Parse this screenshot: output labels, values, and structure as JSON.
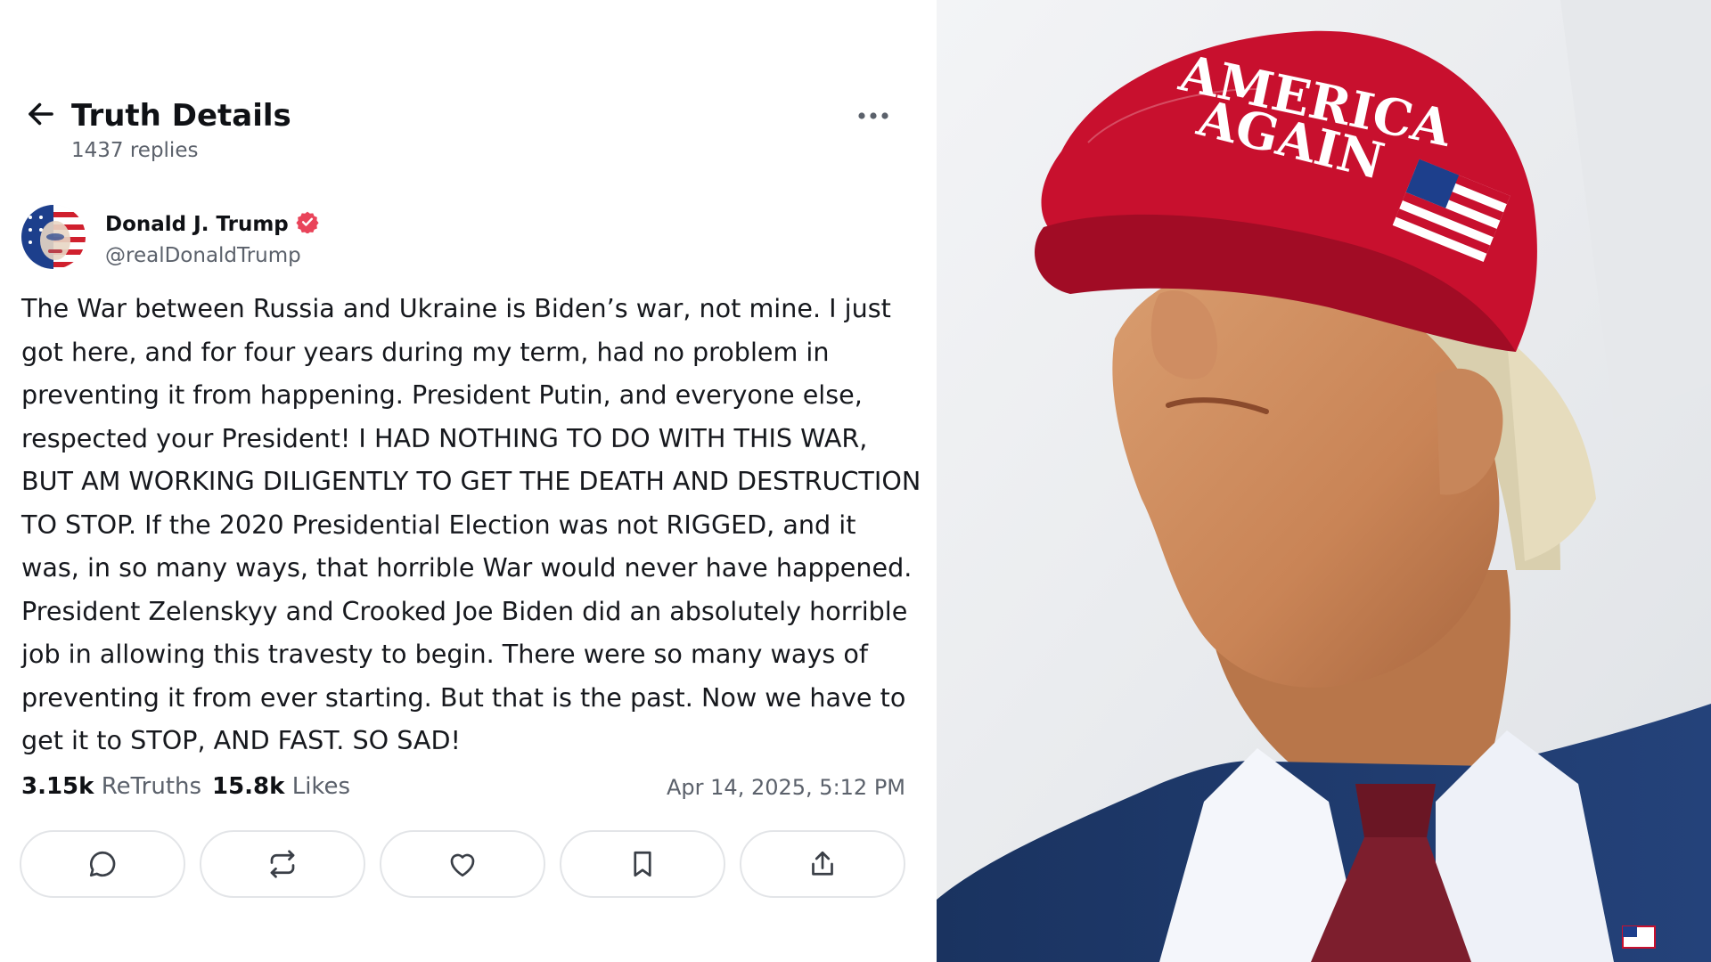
{
  "header": {
    "title": "Truth Details",
    "replies": "1437 replies"
  },
  "post": {
    "author_name": "Donald J. Trump",
    "handle": "@realDonaldTrump",
    "text": "The War between Russia and Ukraine is Biden’s war, not mine. I just got here, and for four years during my term, had no problem in preventing it from happening. President Putin, and everyone else, respected your President! I HAD NOTHING TO DO WITH THIS WAR, BUT AM WORKING DILIGENTLY TO GET THE DEATH AND DESTRUCTION TO STOP. If the 2020 Presidential Election was not RIGGED, and it was, in so many ways, that horrible War would never have happened. President Zelenskyy and Crooked Joe Biden did an absolutely horrible job in allowing this travesty to begin. There were so many ways of preventing it from ever starting. But that is the past. Now we have to get it to STOP, AND FAST. SO SAD!",
    "retruths_count": "3.15k",
    "retruths_label": "ReTruths",
    "likes_count": "15.8k",
    "likes_label": "Likes",
    "timestamp": "Apr 14, 2025, 5:12 PM"
  },
  "photo": {
    "cap_text_line1": "AMERICA",
    "cap_text_line2": "AGAIN"
  },
  "icons": {
    "back": "arrow-left-icon",
    "more": "more-horizontal-icon",
    "verified": "verified-badge-icon",
    "reply": "reply-icon",
    "retruth": "retruth-icon",
    "like": "heart-icon",
    "bookmark": "bookmark-icon",
    "share": "share-icon"
  },
  "colors": {
    "verified_badge": "#e9445a",
    "cap_red": "#c8102e",
    "suit_navy": "#1f3a66",
    "text_secondary": "#5b616b"
  }
}
